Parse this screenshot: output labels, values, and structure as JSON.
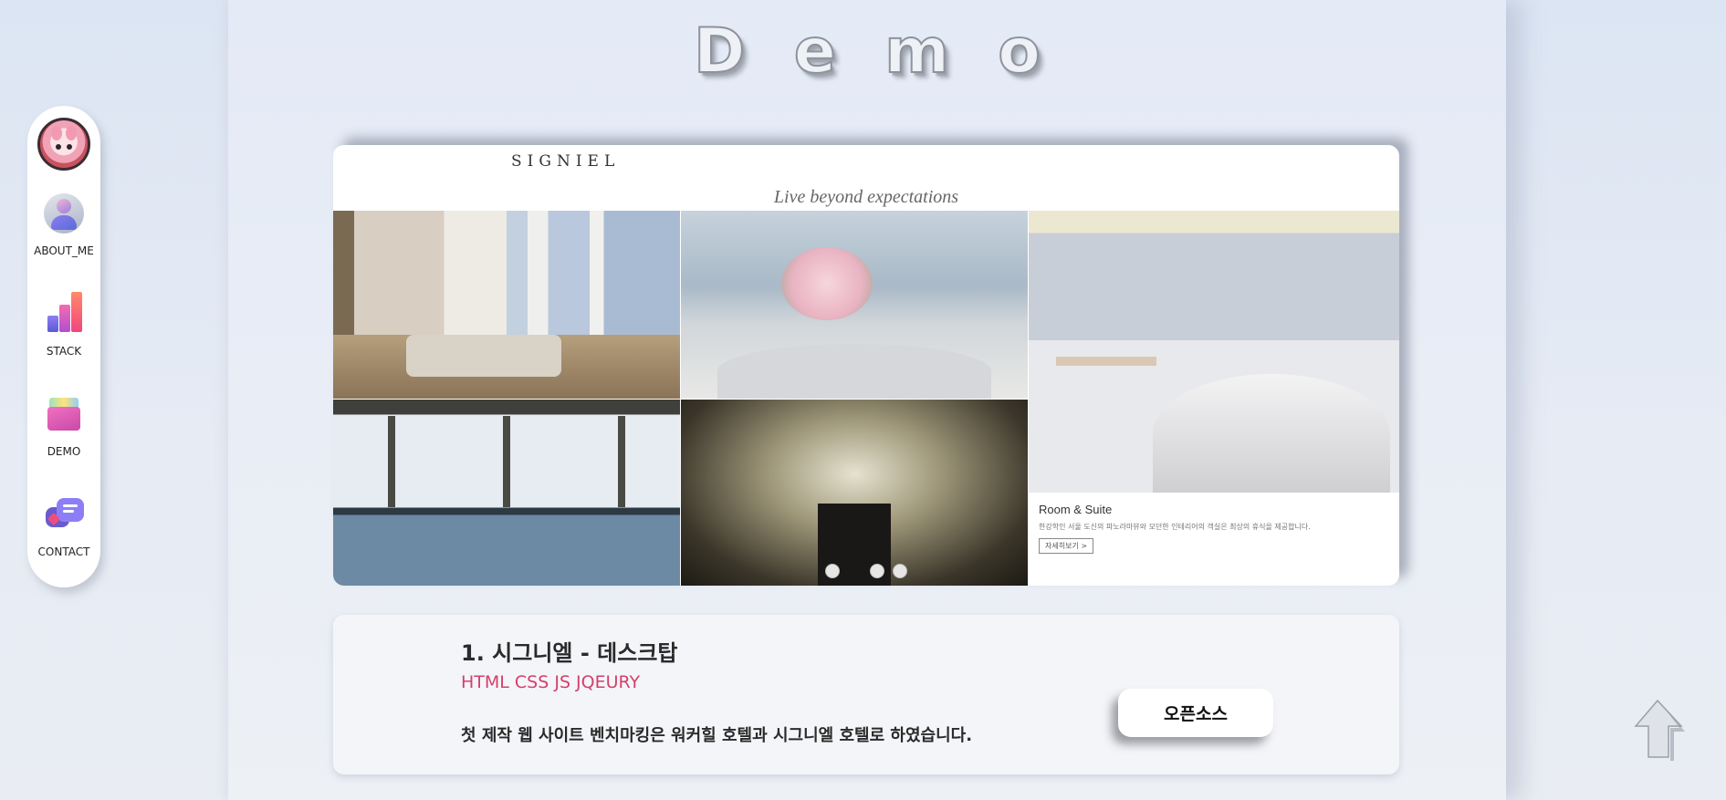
{
  "header": {
    "title_letters": [
      "D",
      "e",
      "m",
      "o"
    ]
  },
  "sidebar": {
    "items": [
      {
        "label": "ABOUT_ME",
        "icon": "person-icon"
      },
      {
        "label": "STACK",
        "icon": "bar-chart-icon"
      },
      {
        "label": "DEMO",
        "icon": "folder-icon"
      },
      {
        "label": "CONTACT",
        "icon": "chat-bubbles-icon"
      }
    ]
  },
  "slider": {
    "logo": "SIGNIEL",
    "tagline": "Live beyond expectations",
    "caption_title": "Room & Suite",
    "caption_text": "한강학인 서울 도신의 파노라마뷰와 모던한 인테리어의 객실은 최상의 휴식을 제공합니다.",
    "caption_button": "자세히보기 >",
    "dot_count": 3,
    "active_dot": 0
  },
  "project": {
    "title": "1. 시그니엘 - 데스크탑",
    "tech": "HTML CSS JS JQEURY",
    "description": "첫 제작 웹 사이트 벤치마킹은 워커힐 호텔과 시그니엘 호텔로 하였습니다.",
    "open_source_label": "오픈소스"
  },
  "colors": {
    "accent": "#d2416b",
    "background": "#dfe6f3"
  }
}
